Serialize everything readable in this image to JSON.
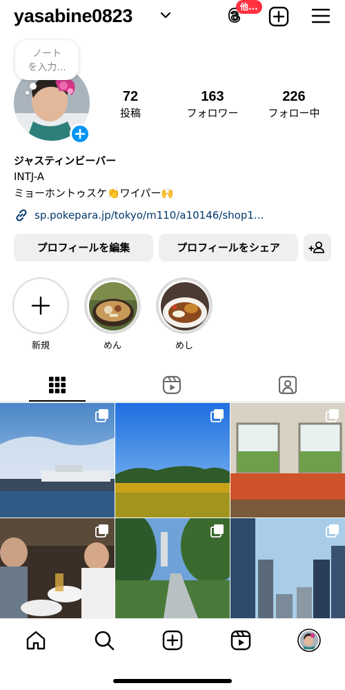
{
  "header": {
    "username": "yasabine0823",
    "threads_badge": "他...",
    "icons": [
      "chevron-down-icon",
      "threads-icon",
      "create-icon",
      "menu-icon"
    ]
  },
  "note": {
    "placeholder_line1": "ノート",
    "placeholder_line2": "を入力..."
  },
  "stats": [
    {
      "value": "72",
      "label": "投稿"
    },
    {
      "value": "163",
      "label": "フォロワー"
    },
    {
      "value": "226",
      "label": "フォロー中"
    }
  ],
  "bio": {
    "name": "ジャスティンビーバー",
    "line1": "INTJ-A",
    "line2": "ミョーホントゥスケ👏ワイパー🙌",
    "link": "sp.pokepara.jp/tokyo/m110/a10146/shop1..."
  },
  "buttons": {
    "edit_profile": "プロフィールを編集",
    "share_profile": "プロフィールをシェア"
  },
  "highlights": [
    {
      "label": "新規"
    },
    {
      "label": "めん"
    },
    {
      "label": "めし"
    }
  ],
  "tabs": [
    "grid-icon",
    "reels-icon",
    "tagged-icon"
  ],
  "bottom_nav": [
    "home-icon",
    "search-icon",
    "create-icon",
    "reels-icon",
    "profile-avatar"
  ],
  "colors": {
    "accent_blue": "#0095f6",
    "link_color": "#00376b",
    "badge_red": "#ff3040",
    "button_bg": "#efefef"
  }
}
